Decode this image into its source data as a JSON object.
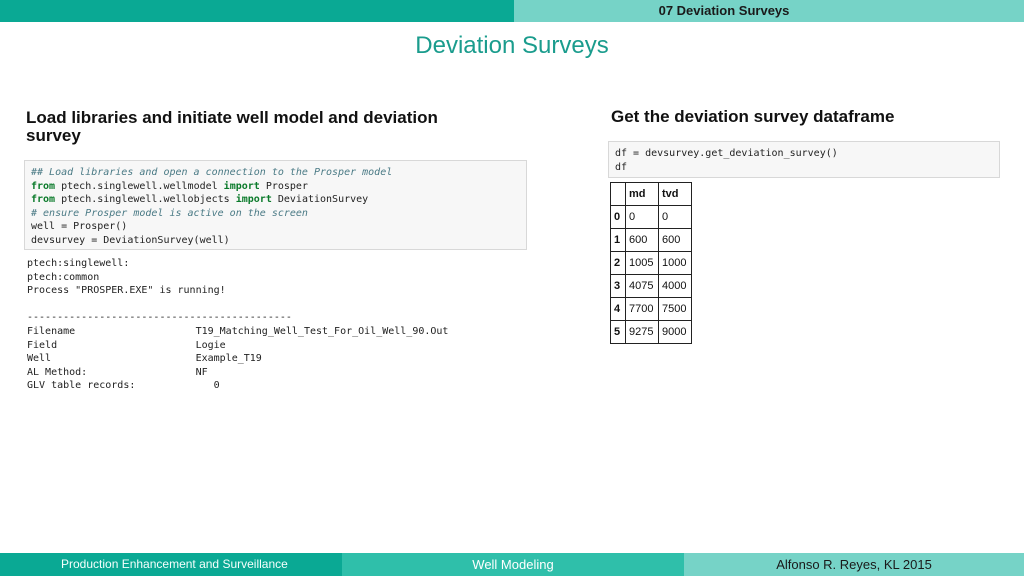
{
  "header": {
    "section_label": "07 Deviation Surveys"
  },
  "title": "Deviation Surveys",
  "left": {
    "heading_line1": "Load libraries and initiate well model and deviation",
    "heading_line2": "survey",
    "code_lines": [
      {
        "parts": [
          {
            "t": "## Load libraries and open a connection to the Prosper model",
            "c": "cm"
          }
        ]
      },
      {
        "parts": [
          {
            "t": "from",
            "c": "kw"
          },
          {
            "t": " ptech.singlewell.wellmodel ",
            "c": ""
          },
          {
            "t": "import",
            "c": "kw"
          },
          {
            "t": " Prosper",
            "c": ""
          }
        ]
      },
      {
        "parts": [
          {
            "t": "from",
            "c": "kw"
          },
          {
            "t": " ptech.singlewell.wellobjects ",
            "c": ""
          },
          {
            "t": "import",
            "c": "kw"
          },
          {
            "t": " DeviationSurvey",
            "c": ""
          }
        ]
      },
      {
        "parts": [
          {
            "t": "# ensure Prosper model is active on the screen",
            "c": "cm"
          }
        ]
      },
      {
        "parts": [
          {
            "t": "well = Prosper()",
            "c": ""
          }
        ]
      },
      {
        "parts": [
          {
            "t": "devsurvey = DeviationSurvey(well)",
            "c": ""
          }
        ]
      }
    ],
    "output_lines": [
      "ptech:singlewell:",
      "ptech:common",
      "Process \"PROSPER.EXE\" is running!",
      "",
      "--------------------------------------------",
      "Filename                    T19_Matching_Well_Test_For_Oil_Well_90.Out",
      "Field                       Logie",
      "Well                        Example_T19",
      "AL Method:                  NF",
      "GLV table records:             0"
    ]
  },
  "right": {
    "heading": "Get the deviation survey dataframe",
    "code_lines": [
      "df = devsurvey.get_deviation_survey()",
      "df"
    ],
    "table": {
      "columns": [
        "",
        "md",
        "tvd"
      ],
      "rows": [
        [
          "0",
          "0",
          "0"
        ],
        [
          "1",
          "600",
          "600"
        ],
        [
          "2",
          "1005",
          "1000"
        ],
        [
          "3",
          "4075",
          "4000"
        ],
        [
          "4",
          "7700",
          "7500"
        ],
        [
          "5",
          "9275",
          "9000"
        ]
      ]
    }
  },
  "footer": {
    "left": "Production Enhancement and Surveillance",
    "center": "Well Modeling",
    "right": "Alfonso R. Reyes, KL 2015"
  }
}
